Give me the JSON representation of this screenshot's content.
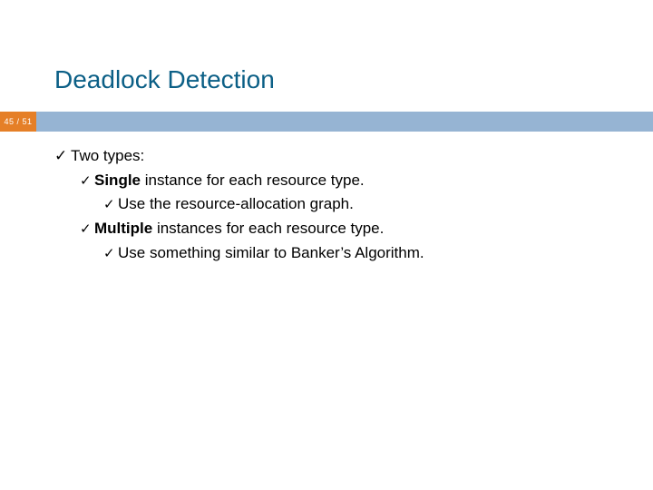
{
  "slide": {
    "title": "Deadlock Detection",
    "page_label": "45 / 51",
    "bullets": {
      "l1_1": "Two types:",
      "l2_1_pre": "Single",
      "l2_1_post": " instance for each resource type.",
      "l3_1": "Use the resource-allocation graph.",
      "l2_2_pre": "Multiple",
      "l2_2_post": " instances for each resource type.",
      "l3_2": "Use something similar to Banker’s Algorithm."
    }
  }
}
